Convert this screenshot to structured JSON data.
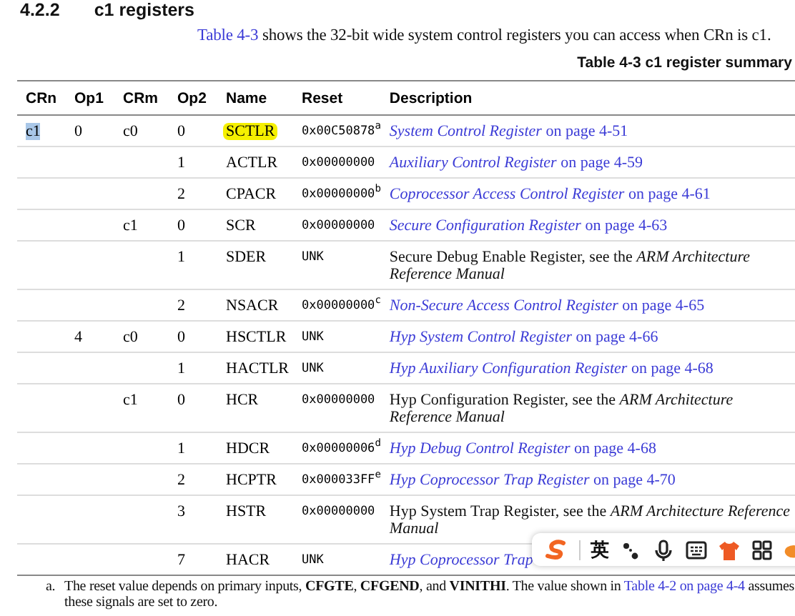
{
  "section": {
    "number": "4.2.2",
    "title": "c1 registers"
  },
  "intro": {
    "link": "Table 4-3",
    "text": " shows the 32-bit wide system control registers you can access when CRn is c1."
  },
  "table": {
    "caption": "Table 4-3 c1 register summary",
    "columns": [
      "CRn",
      "Op1",
      "CRm",
      "Op2",
      "Name",
      "Reset",
      "Description"
    ],
    "rows": [
      {
        "crn": "c1",
        "crn_selected": true,
        "op1": "0",
        "crm": "c0",
        "op2": "0",
        "name": "SCTLR",
        "name_highlighted": true,
        "reset": "0x00C50878$^{a}$",
        "kind": "link",
        "description": "*System Control Register* on page 4-51"
      },
      {
        "op2": "1",
        "name": "ACTLR",
        "name_highlighted": false,
        "reset": "0x00000000",
        "kind": "link",
        "description": "*Auxiliary Control Register* on page 4-59"
      },
      {
        "op2": "2",
        "name": "CPACR",
        "name_highlighted": false,
        "reset": "0x00000000$^{b}$",
        "kind": "link",
        "description": "*Coprocessor Access Control Register* on page 4-61"
      },
      {
        "crm": "c1",
        "op2": "0",
        "name": "SCR",
        "name_highlighted": false,
        "reset": "0x00000000",
        "kind": "link",
        "description": "*Secure Configuration Register* on page 4-63"
      },
      {
        "op2": "1",
        "name": "SDER",
        "name_highlighted": false,
        "reset": "UNK",
        "kind": "text",
        "description": "Secure Debug Enable Register, see the *ARM Architecture Reference Manual*"
      },
      {
        "op2": "2",
        "name": "NSACR",
        "name_highlighted": false,
        "reset": "0x00000000$^{c}$",
        "kind": "link",
        "description": "*Non-Secure Access Control Register* on page 4-65"
      },
      {
        "op1": "4",
        "crm": "c0",
        "op2": "0",
        "name": "HSCTLR",
        "name_highlighted": false,
        "reset": "UNK",
        "kind": "link",
        "description": "*Hyp System Control Register* on page 4-66"
      },
      {
        "op2": "1",
        "name": "HACTLR",
        "name_highlighted": false,
        "reset": "UNK",
        "kind": "link",
        "description": "*Hyp Auxiliary Configuration Register* on page 4-68"
      },
      {
        "crm": "c1",
        "op2": "0",
        "name": "HCR",
        "name_highlighted": false,
        "reset": "0x00000000",
        "kind": "text",
        "description": "Hyp Configuration Register, see the *ARM Architecture Reference Manual*"
      },
      {
        "op2": "1",
        "name": "HDCR",
        "name_highlighted": false,
        "reset": "0x00000006$^{d}$",
        "kind": "link",
        "description": "*Hyp Debug Control Register* on page 4-68"
      },
      {
        "op2": "2",
        "name": "HCPTR",
        "name_highlighted": false,
        "reset": "0x000033FF$^{e}$",
        "kind": "link",
        "description": "*Hyp Coprocessor Trap Register* on page 4-70"
      },
      {
        "op2": "3",
        "name": "HSTR",
        "name_highlighted": false,
        "reset": "0x00000000",
        "kind": "text",
        "description": "Hyp System Trap Register, see the *ARM Architecture Reference Manual*"
      },
      {
        "op2": "7",
        "name": "HACR",
        "name_highlighted": false,
        "reset": "UNK",
        "kind": "link",
        "description": "*Hyp Coprocessor Trap*"
      }
    ]
  },
  "footnotes": [
    {
      "mark": "a.",
      "text": "The reset value depends on primary inputs, **CFGTE**, **CFGEND**, and **VINITHI**. The value shown in ",
      "link": "Table 4-2 on page 4-4",
      "after": " assumes these signals are set to zero."
    }
  ],
  "ime_toolbar": {
    "language": "英"
  }
}
